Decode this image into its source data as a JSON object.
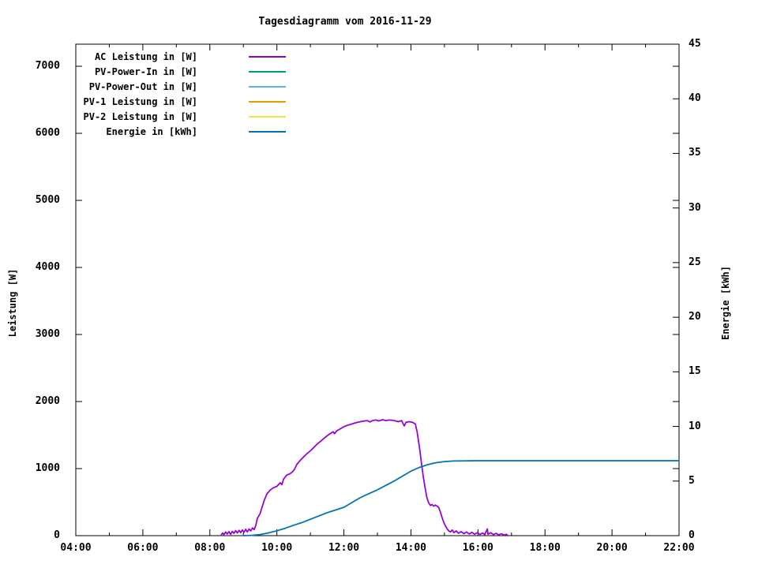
{
  "title": "Tagesdiagramm vom 2016-11-29",
  "colors": {
    "background": "#ffffff",
    "foreground": "#000000"
  },
  "axes": {
    "x": {
      "major_ticks": [
        {
          "hour": 4,
          "label": "04:00"
        },
        {
          "hour": 6,
          "label": "06:00"
        },
        {
          "hour": 8,
          "label": "08:00"
        },
        {
          "hour": 10,
          "label": "10:00"
        },
        {
          "hour": 12,
          "label": "12:00"
        },
        {
          "hour": 14,
          "label": "14:00"
        },
        {
          "hour": 16,
          "label": "16:00"
        },
        {
          "hour": 18,
          "label": "18:00"
        },
        {
          "hour": 20,
          "label": "20:00"
        },
        {
          "hour": 22,
          "label": "22:00"
        }
      ],
      "minor_tick_hours": [
        5,
        7,
        9,
        11,
        13,
        15,
        17,
        19,
        21
      ]
    },
    "y_left": {
      "title": "Leistung [W]",
      "ticks": [
        {
          "value": 0,
          "label": "0"
        },
        {
          "value": 1000,
          "label": "1000"
        },
        {
          "value": 2000,
          "label": "2000"
        },
        {
          "value": 3000,
          "label": "3000"
        },
        {
          "value": 4000,
          "label": "4000"
        },
        {
          "value": 5000,
          "label": "5000"
        },
        {
          "value": 6000,
          "label": "6000"
        },
        {
          "value": 7000,
          "label": "7000"
        }
      ]
    },
    "y_right": {
      "title": "Energie [kWh]",
      "ticks": [
        {
          "value": 0,
          "label": "0"
        },
        {
          "value": 5,
          "label": "5"
        },
        {
          "value": 10,
          "label": "10"
        },
        {
          "value": 15,
          "label": "15"
        },
        {
          "value": 20,
          "label": "20"
        },
        {
          "value": 25,
          "label": "25"
        },
        {
          "value": 30,
          "label": "30"
        },
        {
          "value": 35,
          "label": "35"
        },
        {
          "value": 40,
          "label": "40"
        },
        {
          "value": 45,
          "label": "45"
        }
      ]
    }
  },
  "legend": {
    "entries": [
      {
        "label": "AC Leistung in [W]",
        "color": "#9400d3"
      },
      {
        "label": "PV-Power-In in [W]",
        "color": "#009e73"
      },
      {
        "label": "PV-Power-Out in [W]",
        "color": "#56b4e9"
      },
      {
        "label": "PV-1 Leistung in [W]",
        "color": "#e69f00"
      },
      {
        "label": "PV-2 Leistung in [W]",
        "color": "#f0e442"
      },
      {
        "label": "Energie in [kWh]",
        "color": "#0072b2"
      }
    ]
  },
  "chart_data": {
    "type": "line",
    "title": "Tagesdiagramm vom 2016-11-29",
    "xlabel": "",
    "x_unit": "hour_of_day",
    "x_range": [
      4,
      22
    ],
    "y_left_label": "Leistung [W]",
    "y_left_range": [
      0,
      7330
    ],
    "y_right_label": "Energie [kWh]",
    "y_right_range": [
      0,
      45
    ],
    "grid": false,
    "legend_position": "inside-top-left",
    "series": [
      {
        "name": "AC Leistung in [W]",
        "axis": "left",
        "color": "#9400d3",
        "points": [
          [
            8.33,
            5
          ],
          [
            8.38,
            40
          ],
          [
            8.42,
            15
          ],
          [
            8.47,
            55
          ],
          [
            8.52,
            25
          ],
          [
            8.57,
            60
          ],
          [
            8.62,
            20
          ],
          [
            8.67,
            65
          ],
          [
            8.72,
            35
          ],
          [
            8.77,
            75
          ],
          [
            8.82,
            40
          ],
          [
            8.87,
            80
          ],
          [
            8.92,
            45
          ],
          [
            8.97,
            85
          ],
          [
            9.02,
            50
          ],
          [
            9.07,
            95
          ],
          [
            9.12,
            55
          ],
          [
            9.17,
            100
          ],
          [
            9.22,
            70
          ],
          [
            9.27,
            115
          ],
          [
            9.32,
            90
          ],
          [
            9.37,
            150
          ],
          [
            9.42,
            260
          ],
          [
            9.5,
            330
          ],
          [
            9.56,
            430
          ],
          [
            9.62,
            520
          ],
          [
            9.7,
            620
          ],
          [
            9.8,
            680
          ],
          [
            9.9,
            715
          ],
          [
            10.0,
            735
          ],
          [
            10.1,
            790
          ],
          [
            10.15,
            760
          ],
          [
            10.2,
            845
          ],
          [
            10.3,
            905
          ],
          [
            10.38,
            920
          ],
          [
            10.46,
            950
          ],
          [
            10.52,
            985
          ],
          [
            10.6,
            1065
          ],
          [
            10.7,
            1125
          ],
          [
            10.8,
            1175
          ],
          [
            10.9,
            1225
          ],
          [
            11.0,
            1265
          ],
          [
            11.1,
            1315
          ],
          [
            11.2,
            1365
          ],
          [
            11.3,
            1405
          ],
          [
            11.4,
            1450
          ],
          [
            11.5,
            1490
          ],
          [
            11.6,
            1525
          ],
          [
            11.68,
            1550
          ],
          [
            11.72,
            1520
          ],
          [
            11.78,
            1560
          ],
          [
            11.9,
            1595
          ],
          [
            12.0,
            1625
          ],
          [
            12.1,
            1645
          ],
          [
            12.2,
            1660
          ],
          [
            12.3,
            1675
          ],
          [
            12.4,
            1690
          ],
          [
            12.5,
            1700
          ],
          [
            12.6,
            1710
          ],
          [
            12.7,
            1715
          ],
          [
            12.78,
            1695
          ],
          [
            12.85,
            1715
          ],
          [
            12.95,
            1725
          ],
          [
            13.05,
            1710
          ],
          [
            13.15,
            1730
          ],
          [
            13.25,
            1715
          ],
          [
            13.35,
            1725
          ],
          [
            13.45,
            1720
          ],
          [
            13.55,
            1710
          ],
          [
            13.62,
            1700
          ],
          [
            13.72,
            1715
          ],
          [
            13.8,
            1635
          ],
          [
            13.85,
            1690
          ],
          [
            13.95,
            1700
          ],
          [
            14.05,
            1690
          ],
          [
            14.13,
            1665
          ],
          [
            14.18,
            1560
          ],
          [
            14.22,
            1430
          ],
          [
            14.27,
            1260
          ],
          [
            14.32,
            1060
          ],
          [
            14.37,
            880
          ],
          [
            14.42,
            720
          ],
          [
            14.47,
            580
          ],
          [
            14.52,
            500
          ],
          [
            14.58,
            450
          ],
          [
            14.63,
            465
          ],
          [
            14.68,
            440
          ],
          [
            14.73,
            455
          ],
          [
            14.78,
            440
          ],
          [
            14.83,
            420
          ],
          [
            14.88,
            350
          ],
          [
            14.93,
            270
          ],
          [
            14.98,
            200
          ],
          [
            15.03,
            145
          ],
          [
            15.08,
            100
          ],
          [
            15.13,
            70
          ],
          [
            15.18,
            55
          ],
          [
            15.23,
            85
          ],
          [
            15.28,
            45
          ],
          [
            15.35,
            70
          ],
          [
            15.42,
            35
          ],
          [
            15.5,
            60
          ],
          [
            15.58,
            30
          ],
          [
            15.66,
            55
          ],
          [
            15.74,
            25
          ],
          [
            15.82,
            50
          ],
          [
            15.9,
            20
          ],
          [
            15.98,
            45
          ],
          [
            16.06,
            18
          ],
          [
            16.14,
            40
          ],
          [
            16.2,
            15
          ],
          [
            16.28,
            100
          ],
          [
            16.3,
            20
          ],
          [
            16.38,
            45
          ],
          [
            16.46,
            15
          ],
          [
            16.54,
            35
          ],
          [
            16.62,
            10
          ],
          [
            16.7,
            30
          ],
          [
            16.78,
            8
          ],
          [
            16.85,
            20
          ],
          [
            16.9,
            0
          ]
        ]
      },
      {
        "name": "PV-Power-In in [W]",
        "axis": "left",
        "color": "#009e73",
        "points": []
      },
      {
        "name": "PV-Power-Out in [W]",
        "axis": "left",
        "color": "#56b4e9",
        "points": []
      },
      {
        "name": "PV-1 Leistung in [W]",
        "axis": "left",
        "color": "#e69f00",
        "points": []
      },
      {
        "name": "PV-2 Leistung in [W]",
        "axis": "left",
        "color": "#f0e442",
        "points": []
      },
      {
        "name": "Energie in [kWh]",
        "axis": "right",
        "color": "#0072b2",
        "points": [
          [
            9.0,
            0
          ],
          [
            9.25,
            0.03
          ],
          [
            9.5,
            0.1
          ],
          [
            9.75,
            0.25
          ],
          [
            10.0,
            0.45
          ],
          [
            10.25,
            0.68
          ],
          [
            10.5,
            0.95
          ],
          [
            10.75,
            1.2
          ],
          [
            11.0,
            1.5
          ],
          [
            11.25,
            1.8
          ],
          [
            11.5,
            2.1
          ],
          [
            11.75,
            2.35
          ],
          [
            12.0,
            2.6
          ],
          [
            12.25,
            3.05
          ],
          [
            12.5,
            3.5
          ],
          [
            12.75,
            3.85
          ],
          [
            13.0,
            4.2
          ],
          [
            13.25,
            4.6
          ],
          [
            13.5,
            5.0
          ],
          [
            13.75,
            5.45
          ],
          [
            14.0,
            5.9
          ],
          [
            14.25,
            6.25
          ],
          [
            14.5,
            6.5
          ],
          [
            14.75,
            6.68
          ],
          [
            15.0,
            6.78
          ],
          [
            15.25,
            6.83
          ],
          [
            15.5,
            6.85
          ],
          [
            16.0,
            6.86
          ],
          [
            18.0,
            6.86
          ],
          [
            20.0,
            6.86
          ],
          [
            22.0,
            6.86
          ]
        ]
      }
    ]
  }
}
